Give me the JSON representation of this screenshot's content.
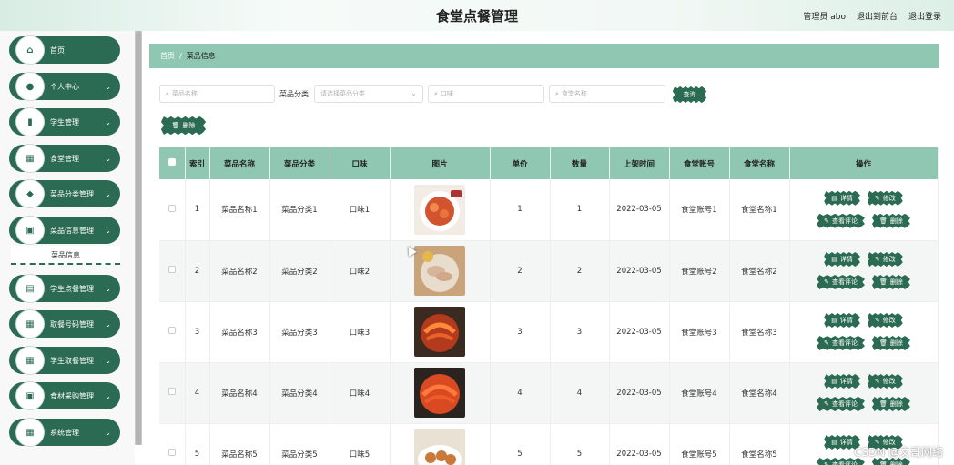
{
  "header": {
    "title": "食堂点餐管理",
    "admin": "管理员 abo",
    "back_front": "退出到前台",
    "logout": "退出登录"
  },
  "sidebar": {
    "items": [
      {
        "label": "首页",
        "icon": "home-icon",
        "glyph": "⌂",
        "chevron": false
      },
      {
        "label": "个人中心",
        "icon": "user-icon",
        "glyph": "●",
        "chevron": true
      },
      {
        "label": "学生管理",
        "icon": "chart-icon",
        "glyph": "▮",
        "chevron": true
      },
      {
        "label": "食堂管理",
        "icon": "grid-icon",
        "glyph": "▦",
        "chevron": true
      },
      {
        "label": "菜品分类管理",
        "icon": "tag-icon",
        "glyph": "◆",
        "chevron": true
      },
      {
        "label": "菜品信息管理",
        "icon": "doc-icon",
        "glyph": "▣",
        "chevron": true
      },
      {
        "label": "学生点餐管理",
        "icon": "list-icon",
        "glyph": "▤",
        "chevron": true
      },
      {
        "label": "取餐号码管理",
        "icon": "grid-icon",
        "glyph": "▦",
        "chevron": true
      },
      {
        "label": "学生取餐管理",
        "icon": "grid-icon",
        "glyph": "▦",
        "chevron": true
      },
      {
        "label": "食材采购管理",
        "icon": "doc-icon",
        "glyph": "▣",
        "chevron": true
      },
      {
        "label": "系统管理",
        "icon": "grid-icon",
        "glyph": "▦",
        "chevron": true
      }
    ],
    "submenu_active": "菜品信息"
  },
  "breadcrumb": {
    "home": "首页",
    "separator": "/",
    "current": "菜品信息"
  },
  "search": {
    "name_placeholder": "菜品名称",
    "category_label": "菜品分类",
    "category_placeholder": "请选择菜品分类",
    "taste_placeholder": "口味",
    "canteen_placeholder": "食堂名称",
    "query_label": "查询",
    "delete_label": "删除"
  },
  "table": {
    "headers": [
      "索引",
      "菜品名称",
      "菜品分类",
      "口味",
      "图片",
      "单价",
      "数量",
      "上架时间",
      "食堂账号",
      "食堂名称",
      "操作"
    ],
    "rows": [
      {
        "index": "1",
        "name": "菜品名称1",
        "category": "菜品分类1",
        "taste": "口味1",
        "price": "1",
        "qty": "1",
        "date": "2022-03-05",
        "account": "食堂账号1",
        "canteen": "食堂名称1"
      },
      {
        "index": "2",
        "name": "菜品名称2",
        "category": "菜品分类2",
        "taste": "口味2",
        "price": "2",
        "qty": "2",
        "date": "2022-03-05",
        "account": "食堂账号2",
        "canteen": "食堂名称2"
      },
      {
        "index": "3",
        "name": "菜品名称3",
        "category": "菜品分类3",
        "taste": "口味3",
        "price": "3",
        "qty": "3",
        "date": "2022-03-05",
        "account": "食堂账号3",
        "canteen": "食堂名称3"
      },
      {
        "index": "4",
        "name": "菜品名称4",
        "category": "菜品分类4",
        "taste": "口味4",
        "price": "4",
        "qty": "4",
        "date": "2022-03-05",
        "account": "食堂账号4",
        "canteen": "食堂名称4"
      },
      {
        "index": "5",
        "name": "菜品名称5",
        "category": "菜品分类5",
        "taste": "口味5",
        "price": "5",
        "qty": "5",
        "date": "2022-03-05",
        "account": "食堂账号5",
        "canteen": "食堂名称5"
      }
    ],
    "ops": {
      "detail": "详情",
      "edit": "修改",
      "review": "查看评论",
      "delete": "删除"
    }
  },
  "watermark": "CSDN @文哥网络",
  "colors": {
    "primary": "#2b6a53",
    "header_row": "#8fc7b2"
  }
}
